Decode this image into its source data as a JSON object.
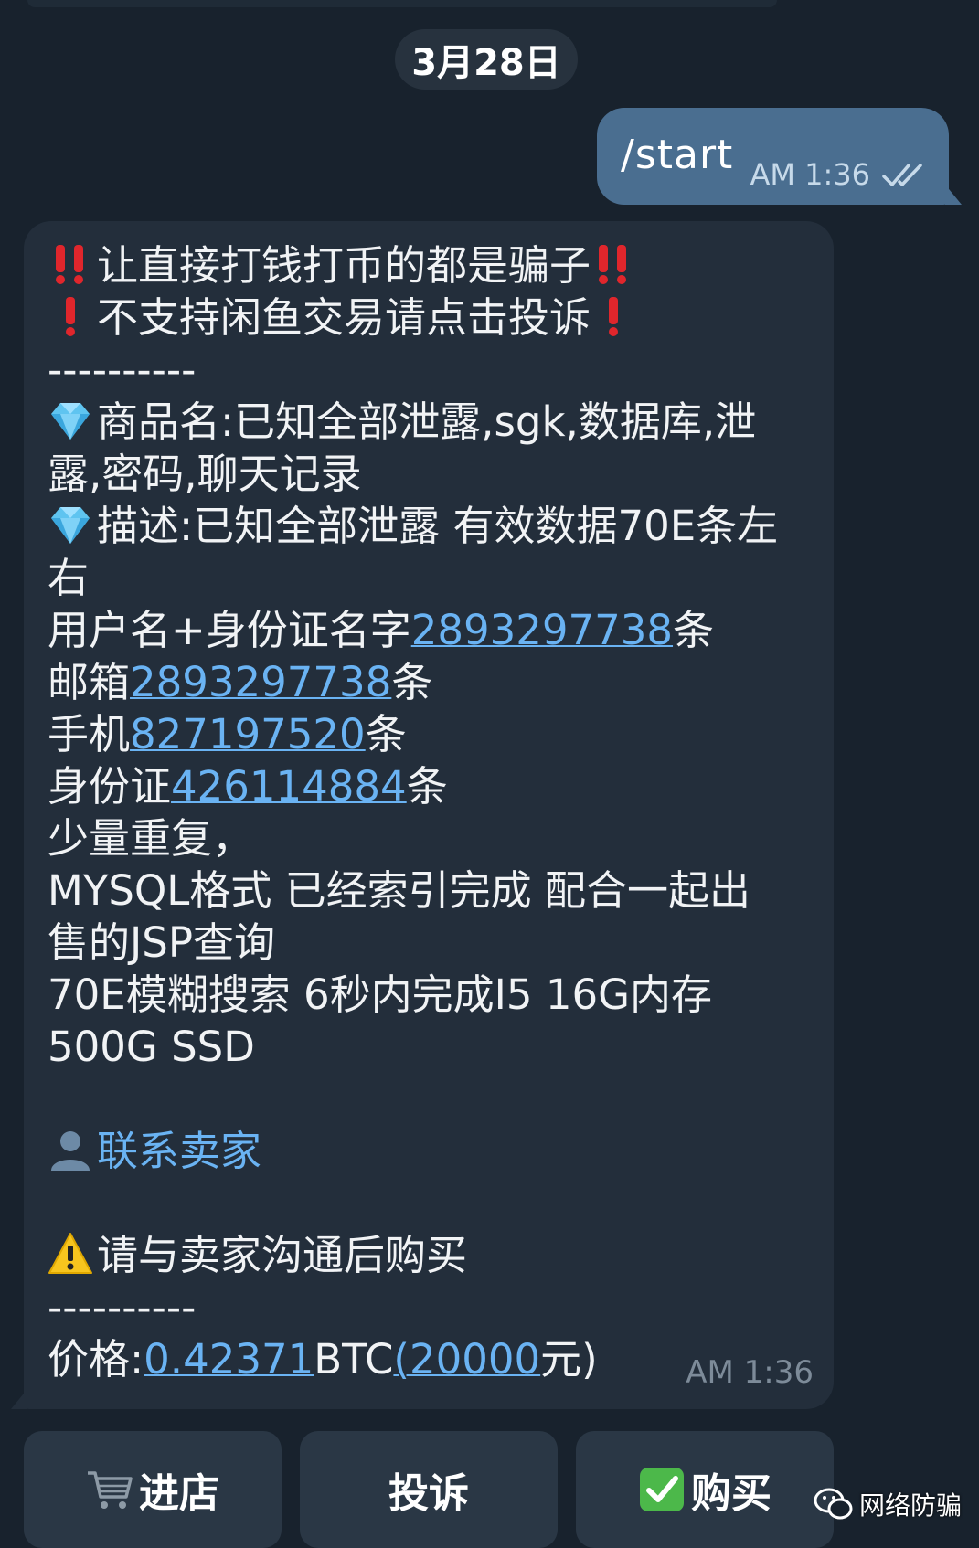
{
  "date_separator": "3月28日",
  "outgoing": {
    "text": "/start",
    "time": "AM 1:36"
  },
  "incoming": {
    "line1": "让直接打钱打币的都是骗子",
    "line2": "不支持闲鱼交易请点击投诉",
    "divider": "----------",
    "product_line1": "商品名:已知全部泄露,sgk,数据库,泄",
    "product_line2": "露,密码,聊天记录",
    "desc_line1": "描述:已知全部泄露 有效数据70E条左",
    "desc_line2": "右",
    "username_prefix": "用户名+身份证名字",
    "username_count": "2893297738",
    "unit": "条",
    "email_prefix": "邮箱",
    "email_count": "2893297738",
    "phone_prefix": "手机",
    "phone_count": "827197520",
    "id_prefix": "身份证",
    "id_count": "426114884",
    "dup_line": "少量重复，",
    "mysql_line1": "MYSQL格式 已经索引完成 配合一起出",
    "mysql_line2": "售的JSP查询",
    "fuzzy_line": "70E模糊搜索 6秒内完成I5 16G内存",
    "ssd_line": "500G SSD",
    "contact_seller": "联系卖家",
    "warning_line": "请与卖家沟通后购买",
    "divider2": "----------",
    "price_prefix": "价格:",
    "price_btc": "0.42371",
    "price_btc_unit": "BTC",
    "price_paren_open": "(",
    "price_cny": "20000",
    "price_cny_suffix": "元)",
    "time": "AM 1:36"
  },
  "buttons": {
    "shop": "进店",
    "complain": "投诉",
    "buy": "购买"
  },
  "watermark": "网络防骗",
  "icons": {
    "double_exclaim": "double-exclamation-icon",
    "exclaim": "exclamation-icon",
    "gem": "gem-icon",
    "person": "person-icon",
    "warning": "warning-icon",
    "cart": "cart-icon",
    "check": "check-mark-icon"
  },
  "colors": {
    "background": "#18222d",
    "incoming_bubble": "#232e3b",
    "outgoing_bubble": "#4a6e90",
    "link": "#6ab3f3",
    "button": "#2a3745"
  }
}
